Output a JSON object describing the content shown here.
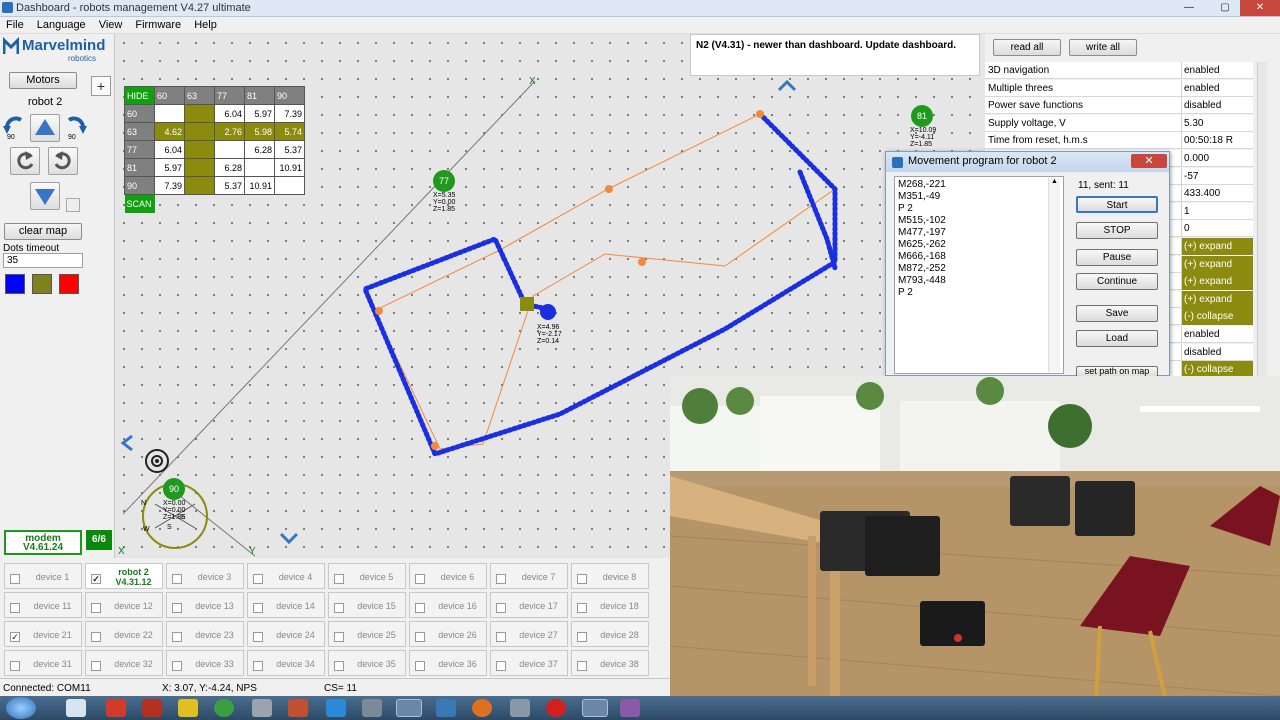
{
  "window": {
    "title": "Dashboard - robots management   V4.27   ultimate",
    "minimize": "—",
    "maximize": "▢",
    "close": "✕"
  },
  "menu": [
    "File",
    "Language",
    "View",
    "Firmware",
    "Help"
  ],
  "left": {
    "logo_main": "Marvelmind",
    "logo_sub": "robotics",
    "motors_label": "Motors",
    "robot_label": "robot 2",
    "rot_left_label": "90",
    "rot_right_label": "90",
    "clear_map_label": "clear map",
    "dots_timeout_label": "Dots timeout",
    "dots_timeout_value": "35",
    "color_swatches": [
      "#0000ff",
      "#808020",
      "#ff0000"
    ],
    "modem_label": "modem",
    "modem_version": "V4.61.24",
    "count_badge": "6/6"
  },
  "table": {
    "header": [
      "HIDE",
      "60",
      "63",
      "77",
      "81",
      "90"
    ],
    "rows": [
      [
        "60",
        "",
        "",
        "6.04",
        "5.97",
        "7.39"
      ],
      [
        "63",
        "4.62",
        "",
        "2.76",
        "5.98",
        "5.74"
      ],
      [
        "77",
        "6.04",
        "",
        "",
        "6.28",
        "5.37"
      ],
      [
        "81",
        "5.97",
        "",
        "6.28",
        "",
        "10.91"
      ],
      [
        "90",
        "7.39",
        "",
        "5.37",
        "10.91",
        ""
      ]
    ],
    "scan_label": "SCAN"
  },
  "map": {
    "beacons": [
      {
        "id": "77",
        "text": [
          "X=5.35",
          "Y=0.00",
          "Z=1.85"
        ]
      },
      {
        "id": "81",
        "text": [
          "X=10.09",
          "Y=-4.11",
          "Z=1.85"
        ]
      },
      {
        "id": "90",
        "text": [
          "X=0.00",
          "Y=0.00",
          "Z=1.85"
        ]
      }
    ],
    "robot_text": [
      "X=4.96",
      "Y=-2.17",
      "Z=0.14"
    ],
    "axis_x": "X",
    "axis_y": "Y",
    "compass": [
      "N",
      "E",
      "S",
      "W"
    ]
  },
  "notice": "N2 (V4.31)  - newer than dashboard. Update dashboard.",
  "right": {
    "read_all": "read all",
    "write_all": "write all",
    "props": [
      {
        "k": "3D navigation",
        "v": "enabled"
      },
      {
        "k": "Multiple threes",
        "v": "enabled"
      },
      {
        "k": "Power save functions",
        "v": "disabled"
      },
      {
        "k": "Supply voltage, V",
        "v": "5.30"
      },
      {
        "k": "Time from reset, h.m.s",
        "v": "00:50:18   R"
      },
      {
        "k": "",
        "v": "0.000"
      },
      {
        "k": "",
        "v": "-57"
      },
      {
        "k": "",
        "v": "433.400"
      },
      {
        "k": "",
        "v": "1"
      },
      {
        "k": "",
        "v": "0"
      },
      {
        "k": "",
        "v": "(+) expand",
        "olive": true
      },
      {
        "k": "",
        "v": "(+) expand",
        "olive": true
      },
      {
        "k": "",
        "v": "(+) expand",
        "olive": true
      },
      {
        "k": "",
        "v": "(+) expand",
        "olive": true
      },
      {
        "k": "",
        "v": "(-) collapse",
        "olive": true
      },
      {
        "k": "",
        "v": "enabled"
      },
      {
        "k": "",
        "v": "disabled"
      },
      {
        "k": "",
        "v": "(-) collapse",
        "olive": true
      }
    ]
  },
  "dialog": {
    "title": "Movement program for robot 2",
    "close": "✕",
    "program": [
      "M268,-221",
      "M351,-49",
      "P 2",
      "M515,-102",
      "M477,-197",
      "M625,-262",
      "M666,-168",
      "M872,-252",
      "M793,-448",
      "P 2"
    ],
    "sent": "11, sent: 11",
    "buttons": [
      "Start",
      "STOP",
      "Pause",
      "Continue",
      "Save",
      "Load",
      "set path on map"
    ]
  },
  "devices": [
    {
      "label": "device 1"
    },
    {
      "label": "robot 2",
      "sub": "V4.31.12",
      "active": true,
      "checked": true
    },
    {
      "label": "device 3"
    },
    {
      "label": "device 4"
    },
    {
      "label": "device 5"
    },
    {
      "label": "device 6"
    },
    {
      "label": "device 7"
    },
    {
      "label": "device 8"
    },
    {
      "label": "device 11"
    },
    {
      "label": "device 12"
    },
    {
      "label": "device 13"
    },
    {
      "label": "device 14"
    },
    {
      "label": "device 15"
    },
    {
      "label": "device 16"
    },
    {
      "label": "device 17"
    },
    {
      "label": "device 18"
    },
    {
      "label": "device 21",
      "checked": true
    },
    {
      "label": "device 22"
    },
    {
      "label": "device 23"
    },
    {
      "label": "device 24"
    },
    {
      "label": "device 25"
    },
    {
      "label": "device 26"
    },
    {
      "label": "device 27"
    },
    {
      "label": "device 28"
    },
    {
      "label": "device 31"
    },
    {
      "label": "device 32"
    },
    {
      "label": "device 33"
    },
    {
      "label": "device 34"
    },
    {
      "label": "device 35"
    },
    {
      "label": "device 36"
    },
    {
      "label": "device 37"
    },
    {
      "label": "device 38"
    }
  ],
  "status": {
    "connection": "Connected: COM11",
    "coords": "X: 3.07, Y:-4.24, NPS",
    "cs": "CS= 11"
  },
  "colors": {
    "path_blue": "#1a2fe0",
    "route_orange": "#f28a3c",
    "beacon_green": "#1f9a1f",
    "olive": "#8b8b10"
  }
}
